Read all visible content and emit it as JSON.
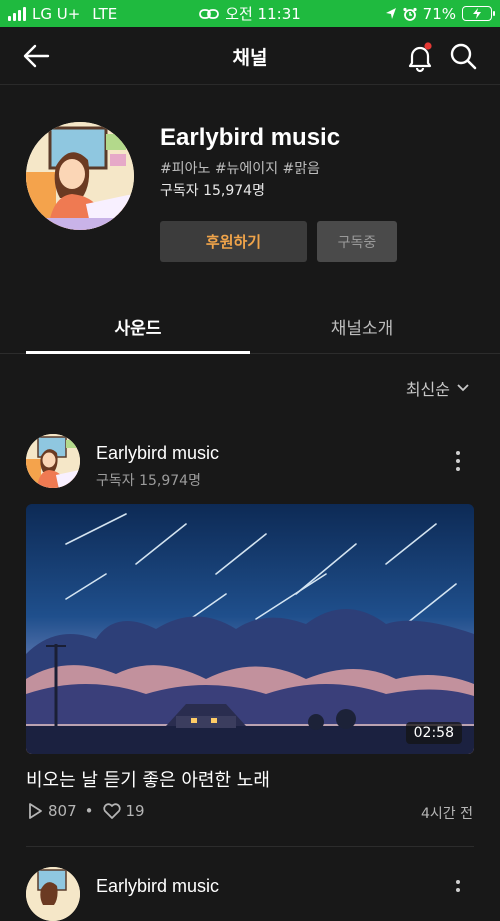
{
  "status_bar": {
    "carrier": "LG U+",
    "network": "LTE",
    "time": "오전 11:31",
    "battery": "71%"
  },
  "header": {
    "title": "채널"
  },
  "channel": {
    "name": "Earlybird music",
    "tags": "#피아노 #뉴에이지 #맑음",
    "subscribers": "구독자 15,974명",
    "support_button": "후원하기",
    "subscribed_button": "구독중"
  },
  "tabs": [
    {
      "label": "사운드",
      "active": true
    },
    {
      "label": "채널소개",
      "active": false
    }
  ],
  "sort": {
    "label": "최신순"
  },
  "posts": [
    {
      "author": "Earlybird music",
      "subscribers": "구독자 15,974명",
      "duration": "02:58",
      "title": "비오는 날 듣기 좋은 아련한 노래",
      "plays": "807",
      "likes": "19",
      "time": "4시간 전"
    },
    {
      "author": "Earlybird music"
    }
  ],
  "colors": {
    "status_bar": "#1fba3f",
    "background": "#181818",
    "accent_orange": "#f0a44a",
    "notification_dot": "#e53935"
  },
  "icons": [
    "back-arrow-icon",
    "bell-icon",
    "search-icon",
    "chevron-down-icon",
    "more-vertical-icon",
    "play-icon",
    "heart-icon"
  ]
}
